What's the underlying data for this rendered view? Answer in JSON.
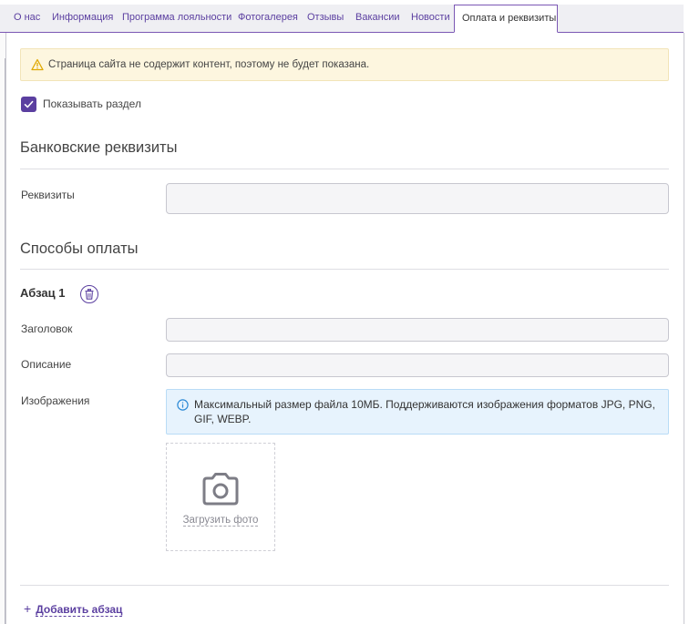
{
  "tabs": [
    {
      "label": "О нас",
      "active": false
    },
    {
      "label": "Информация",
      "active": false
    },
    {
      "label": "Программа лояльности",
      "active": false
    },
    {
      "label": "Фотогалерея",
      "active": false
    },
    {
      "label": "Отзывы",
      "active": false
    },
    {
      "label": "Вакансии",
      "active": false
    },
    {
      "label": "Новости",
      "active": false
    },
    {
      "label": "Оплата и реквизиты",
      "active": true
    }
  ],
  "warning": {
    "text": "Страница сайта не содержит контент, поэтому не будет показана.",
    "icon": "warning-icon",
    "color": "#f0b429"
  },
  "show_section": {
    "label": "Показывать раздел",
    "checked": true
  },
  "bank_section": {
    "title": "Банковские реквизиты",
    "requisites_label": "Реквизиты",
    "requisites_value": ""
  },
  "payment_section": {
    "title": "Способы оплаты",
    "paragraph": {
      "title": "Абзац 1",
      "heading_label": "Заголовок",
      "heading_value": "",
      "description_label": "Описание",
      "description_value": "",
      "images_label": "Изображения",
      "info_text": "Максимальный размер файла 10МБ. Поддерживаются изображения форматов JPG, PNG, GIF, WEBP.",
      "upload_label": "Загрузить фото"
    },
    "add_paragraph_label": "Добавить абзац"
  },
  "colors": {
    "accent": "#5b3fa0",
    "warning_bg": "#fdf6df",
    "info_bg": "#e7f3fd",
    "info_icon": "#2d8ad6"
  }
}
